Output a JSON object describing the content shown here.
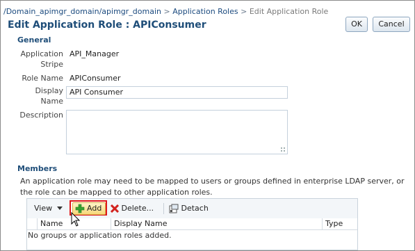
{
  "breadcrumb": {
    "domain_link": "/Domain_apimgr_domain/apimgr_domain",
    "sep1": ">",
    "roles_link": "Application Roles",
    "sep2": ">",
    "current": "Edit Application Role"
  },
  "page_title": "Edit Application Role : APIConsumer",
  "buttons": {
    "ok": "OK",
    "cancel": "Cancel"
  },
  "general": {
    "heading": "General",
    "stripe_label_line1": "Application",
    "stripe_label_line2": "Stripe",
    "stripe_value": "API_Manager",
    "role_name_label": "Role Name",
    "role_name_value": "APIConsumer",
    "display_name_label_line1": "Display",
    "display_name_label_line2": "Name",
    "display_name_value": "API Consumer",
    "description_label": "Description",
    "description_value": ""
  },
  "members": {
    "heading": "Members",
    "description": "An application role may need to be mapped to users or groups defined in enterprise LDAP server, or the role can be mapped to other application roles.",
    "toolbar": {
      "view": "View",
      "add": "Add",
      "delete": "Delete...",
      "detach": "Detach"
    },
    "columns": [
      "Name",
      "Display Name",
      "Type"
    ],
    "empty_message": "No groups or application roles added."
  },
  "icons": {
    "add": "plus-icon",
    "delete": "delete-x-icon",
    "detach": "detach-icon",
    "view_dropdown": "chevron-down-icon",
    "cursor": "mouse-pointer-icon"
  },
  "colors": {
    "title": "#1f4e79",
    "link": "#1c4b7f",
    "highlight_border": "#e0181b",
    "add_icon": "#3aa332",
    "delete_icon": "#d2221e"
  }
}
